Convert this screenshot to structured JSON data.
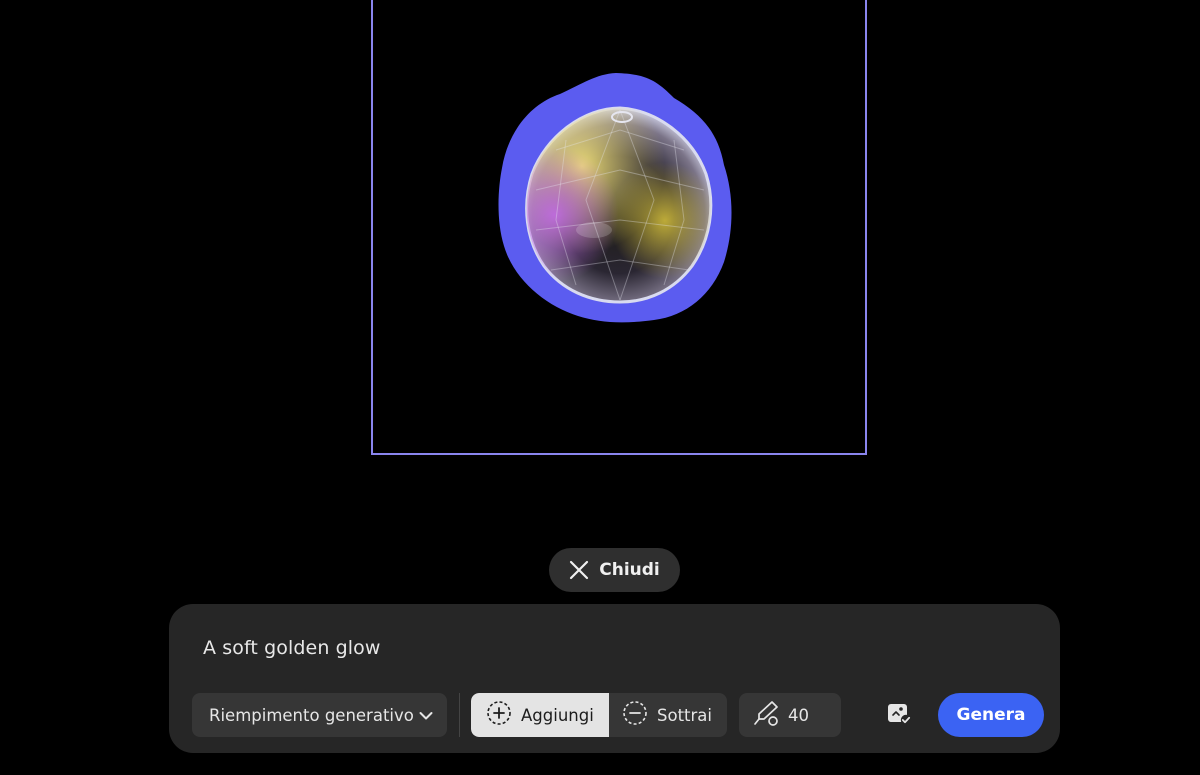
{
  "canvas": {
    "frame_color": "#8a85ee",
    "mask_color": "#5b5cf0",
    "subject": "crystal-ball"
  },
  "close_button": {
    "label": "Chiudi",
    "icon": "close-icon"
  },
  "prompt": {
    "value": "A soft golden glow"
  },
  "toolbar": {
    "mode_label": "Riempimento generativo",
    "mode_icon": "chevron-down-icon",
    "add_label": "Aggiungi",
    "add_icon": "add-selection-icon",
    "subtract_label": "Sottrai",
    "subtract_icon": "subtract-selection-icon",
    "brush_icon": "brush-size-icon",
    "brush_size": "40",
    "feedback_icon": "image-check-icon",
    "generate_label": "Genera"
  },
  "colors": {
    "panel_bg": "#262626",
    "control_bg": "#363636",
    "accent": "#3b63f3",
    "active_segment": "#e4e4e4"
  }
}
